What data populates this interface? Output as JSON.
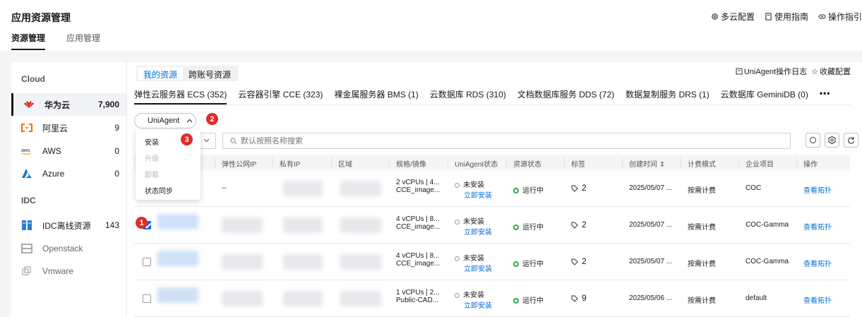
{
  "page_title": "应用资源管理",
  "top_links": [
    {
      "icon": "settings-icon",
      "label": "多云配置"
    },
    {
      "icon": "document-icon",
      "label": "使用指南"
    },
    {
      "icon": "eye-icon",
      "label": "操作指引"
    }
  ],
  "top_tabs": [
    "资源管理",
    "应用管理"
  ],
  "sidebar": {
    "cloud_heading": "Cloud",
    "idc_heading": "IDC",
    "cloud_items": [
      {
        "icon": "huawei-logo-icon",
        "label": "华为云",
        "count": "7,900"
      },
      {
        "icon": "aliyun-logo-icon",
        "label": "阿里云",
        "count": "9"
      },
      {
        "icon": "aws-logo-icon",
        "label": "AWS",
        "count": "0"
      },
      {
        "icon": "azure-logo-icon",
        "label": "Azure",
        "count": "0"
      }
    ],
    "idc_items": [
      {
        "icon": "server-icon",
        "label": "IDC离线资源",
        "count": "143"
      },
      {
        "icon": "openstack-icon",
        "label": "Openstack",
        "count": ""
      },
      {
        "icon": "vmware-icon",
        "label": "Vmware",
        "count": ""
      }
    ]
  },
  "resource_switch": [
    "我的资源",
    "跨账号资源"
  ],
  "right_links": [
    {
      "icon": "log-icon",
      "label": "UniAgent操作日志"
    },
    {
      "icon": "star-icon",
      "label": "收藏配置"
    }
  ],
  "service_tabs": [
    "弹性云服务器 ECS (352)",
    "云容器引擎 CCE (323)",
    "裸金属服务器 BMS (1)",
    "云数据库 RDS (310)",
    "文档数据库服务 DDS (72)",
    "数据复制服务 DRS (1)",
    "云数据库 GeminiDB (0)"
  ],
  "more_label": "•••",
  "uniagent_dropdown": "UniAgent",
  "dropdown_items": [
    {
      "label": "安装",
      "disabled": false
    },
    {
      "label": "升级",
      "disabled": true
    },
    {
      "label": "卸载",
      "disabled": true
    },
    {
      "label": "状态同步",
      "disabled": false
    }
  ],
  "badges": [
    "1",
    "2",
    "3"
  ],
  "search_placeholder": "默认按照名称搜索",
  "columns": [
    "弹性公网IP",
    "私有IP",
    "区域",
    "规格/镜像",
    "UniAgent状态",
    "资源状态",
    "标签",
    "创建时间",
    "计费模式",
    "企业项目",
    "操作"
  ],
  "rows": [
    {
      "checked": false,
      "eip": "--",
      "spec1": "2 vCPUs | 4...",
      "spec2": "CCE_image...",
      "agent": "未安装",
      "agent_link": "立即安装",
      "status": "运行中",
      "tags": "2",
      "created": "2025/05/07 ...",
      "billing": "按需计费",
      "project": "COC",
      "action": "查看拓扑"
    },
    {
      "checked": true,
      "eip": "",
      "spec1": "4 vCPUs | 8...",
      "spec2": "CCE_image...",
      "agent": "未安装",
      "agent_link": "立即安装",
      "status": "运行中",
      "tags": "2",
      "created": "2025/05/07 ...",
      "billing": "按需计费",
      "project": "COC-Gamma",
      "action": "查看拓扑"
    },
    {
      "checked": false,
      "eip": "",
      "spec1": "4 vCPUs | 8...",
      "spec2": "CCE_image...",
      "agent": "未安装",
      "agent_link": "立即安装",
      "status": "运行中",
      "tags": "2",
      "created": "2025/05/07 ...",
      "billing": "按需计费",
      "project": "COC-Gamma",
      "action": "查看拓扑"
    },
    {
      "checked": false,
      "eip": "",
      "spec1": "1 vCPUs | 2...",
      "spec2": "Public-CAD...",
      "agent": "未安装",
      "agent_link": "立即安装",
      "status": "运行中",
      "tags": "9",
      "created": "2025/05/06 ...",
      "billing": "按需计费",
      "project": "default",
      "action": "查看拓扑"
    }
  ],
  "colors": {
    "accent": "#0070d9",
    "badge": "#e12b2b",
    "running": "#2fa84f"
  }
}
